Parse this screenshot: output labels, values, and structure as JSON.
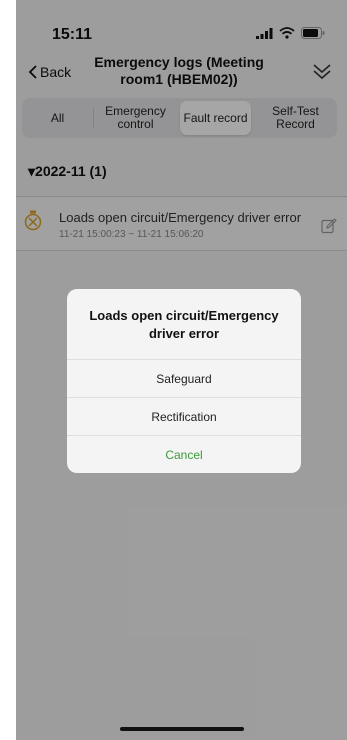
{
  "status_bar": {
    "time": "15:11"
  },
  "nav": {
    "back_label": "Back",
    "title": "Emergency logs (Meeting room1 (HBEM02))"
  },
  "tabs": [
    {
      "label": "All",
      "active": false
    },
    {
      "label": "Emergency control",
      "active": false
    },
    {
      "label": "Fault record",
      "active": true
    },
    {
      "label": "Self-Test Record",
      "active": false
    }
  ],
  "section": {
    "month": "▾2022-11  (1)"
  },
  "records": [
    {
      "title": "Loads open circuit/Emergency driver error",
      "time_range": "11-21 15:00:23 ~ 11-21 15:06:20",
      "icon": "warning-lamp-icon"
    }
  ],
  "modal": {
    "title": "Loads open circuit/Emergency driver error",
    "options": [
      "Safeguard",
      "Rectification",
      "Cancel"
    ]
  },
  "colors": {
    "accent_green": "#3a9a3a",
    "icon_orange": "#d9a12a",
    "overlay": "rgba(0,0,0,0.35)"
  }
}
